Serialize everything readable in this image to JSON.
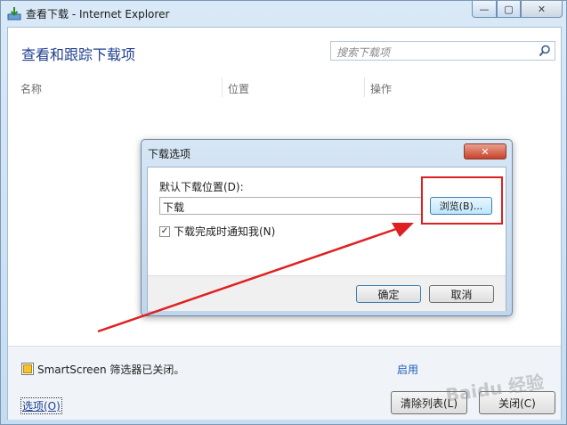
{
  "window": {
    "title": "查看下载 - Internet Explorer",
    "min_glyph": "—",
    "max_glyph": "▢",
    "close_glyph": "✕"
  },
  "main": {
    "heading": "查看和跟踪下载项",
    "search_placeholder": "搜索下载项",
    "columns": [
      "名称",
      "位置",
      "操作"
    ]
  },
  "status": {
    "smartscreen_text": "SmartScreen 筛选器已关闭。",
    "enable_link": "启用",
    "options_link": "选项(O)",
    "clear_list_button": "清除列表(L)",
    "close_button": "关闭(C)"
  },
  "dialog": {
    "title": "下载选项",
    "close_glyph": "✕",
    "default_location_label": "默认下载位置(D):",
    "path_value": "下载",
    "browse_button": "浏览(B)...",
    "notify_checkbox_label": "下载完成时通知我(N)",
    "notify_checked": true,
    "check_glyph": "✓",
    "ok_button": "确定",
    "cancel_button": "取消"
  },
  "annotation": {
    "highlight_color": "#e02020"
  },
  "watermark": "Baidu 经验"
}
